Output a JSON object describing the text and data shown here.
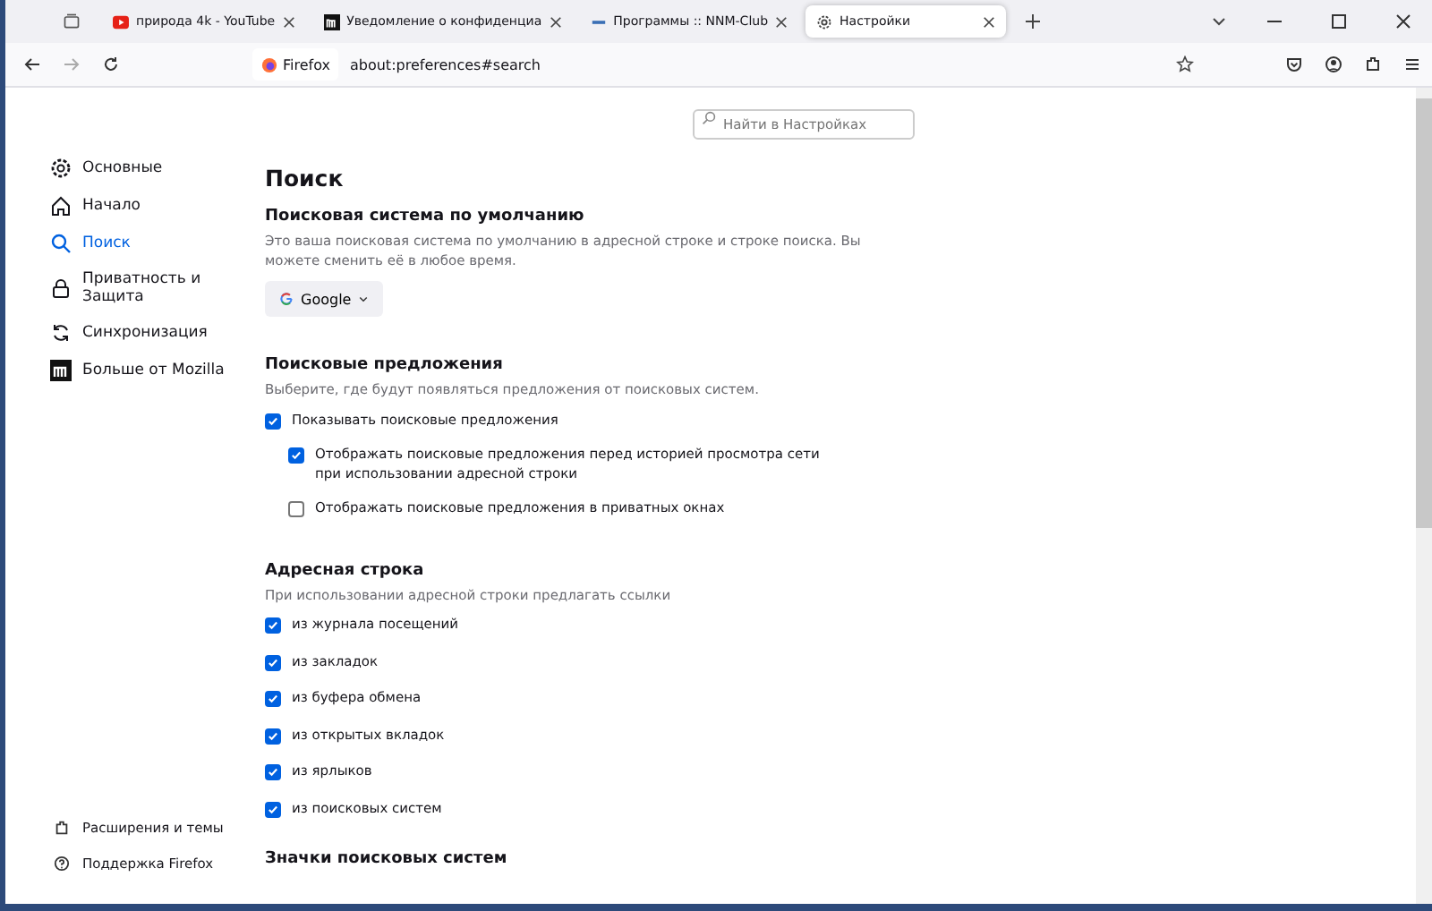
{
  "tabs": [
    {
      "title": "природа 4k - YouTube",
      "kind": "video",
      "selected": false
    },
    {
      "title": "Уведомление о конфиденциа",
      "kind": "m",
      "selected": false
    },
    {
      "title": "Программы :: NNM-Club",
      "kind": "dash",
      "selected": false
    },
    {
      "title": "Настройки",
      "kind": "gear",
      "selected": true
    }
  ],
  "address_bar": {
    "identity": "Firefox",
    "url": "about:preferences#search"
  },
  "search": {
    "placeholder": "Найти в Настройках"
  },
  "sidebar": {
    "items": [
      {
        "label": "Основные",
        "kind": "gear",
        "selected": false
      },
      {
        "label": "Начало",
        "kind": "home",
        "selected": false
      },
      {
        "label": "Поиск",
        "kind": "search",
        "selected": true
      },
      {
        "label": "Приватность и Защита",
        "kind": "lock",
        "selected": false
      },
      {
        "label": "Синхронизация",
        "kind": "sync",
        "selected": false
      },
      {
        "label": "Больше от Mozilla",
        "kind": "m",
        "selected": false
      }
    ],
    "footer": [
      {
        "label": "Расширения и темы",
        "kind": "puzzle"
      },
      {
        "label": "Поддержка Firefox",
        "kind": "help"
      }
    ]
  },
  "page_title": "Поиск",
  "default_engine": {
    "heading": "Поисковая система по умолчанию",
    "description": "Это ваша поисковая система по умолчанию в адресной строке и строке поиска. Вы можете сменить её в любое время.",
    "engine": "Google"
  },
  "suggestions": {
    "heading": "Поисковые предложения",
    "description": "Выберите, где будут появляться предложения от поисковых систем.",
    "options": [
      {
        "label": "Показывать поисковые предложения",
        "checked": true,
        "children": [
          {
            "label": "Отображать поисковые предложения перед историей просмотра сети при использовании адресной строки",
            "checked": true
          },
          {
            "label": "Отображать поисковые предложения в приватных окнах",
            "checked": false
          }
        ]
      }
    ]
  },
  "address_section": {
    "heading": "Адресная строка",
    "description": "При использовании адресной строки предлагать ссылки",
    "options": [
      {
        "label": "из журнала посещений",
        "checked": true
      },
      {
        "label": "из закладок",
        "checked": true
      },
      {
        "label": "из буфера обмена",
        "checked": true
      },
      {
        "label": "из открытых вкладок",
        "checked": true
      },
      {
        "label": "из ярлыков",
        "checked": true
      },
      {
        "label": "из поисковых систем",
        "checked": true
      }
    ]
  },
  "next_heading": "Значки поисковых систем"
}
